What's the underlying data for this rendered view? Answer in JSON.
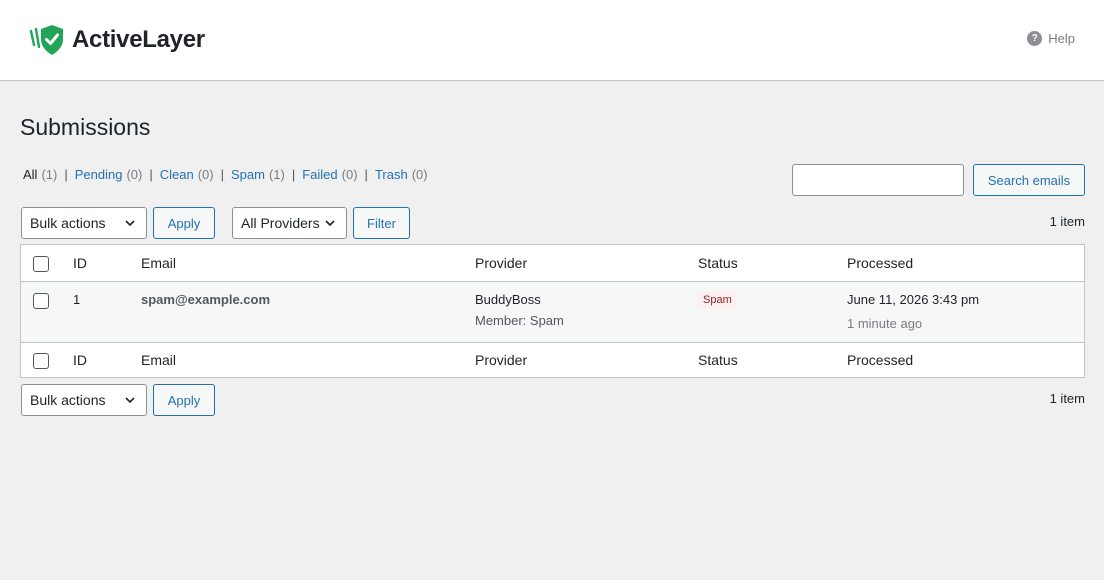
{
  "brand": {
    "name": "ActiveLayer"
  },
  "help": {
    "label": "Help"
  },
  "page": {
    "title": "Submissions"
  },
  "filters": [
    {
      "label": "All",
      "count": "(1)",
      "current": true
    },
    {
      "label": "Pending",
      "count": "(0)"
    },
    {
      "label": "Clean",
      "count": "(0)"
    },
    {
      "label": "Spam",
      "count": "(1)"
    },
    {
      "label": "Failed",
      "count": "(0)"
    },
    {
      "label": "Trash",
      "count": "(0)"
    }
  ],
  "search": {
    "value": "",
    "button_label": "Search emails"
  },
  "top_nav": {
    "bulk_actions": "Bulk actions",
    "apply": "Apply",
    "providers": "All Providers",
    "filter": "Filter",
    "count": "1 item"
  },
  "bottom_nav": {
    "bulk_actions": "Bulk actions",
    "apply": "Apply",
    "count": "1 item"
  },
  "table": {
    "columns": {
      "id": "ID",
      "email": "Email",
      "provider": "Provider",
      "status": "Status",
      "processed": "Processed"
    },
    "rows": [
      {
        "id": "1",
        "email": "spam@example.com",
        "provider": "BuddyBoss",
        "provider_meta": "Member: Spam",
        "status": "Spam",
        "processed": "June 11, 2026 3:43 pm",
        "processed_ago": "1 minute ago"
      }
    ]
  },
  "colors": {
    "accent": "#2271b1",
    "brand_green": "#22a559",
    "spam_badge_bg": "#fcf0f1",
    "spam_badge_text": "#8a2424"
  }
}
